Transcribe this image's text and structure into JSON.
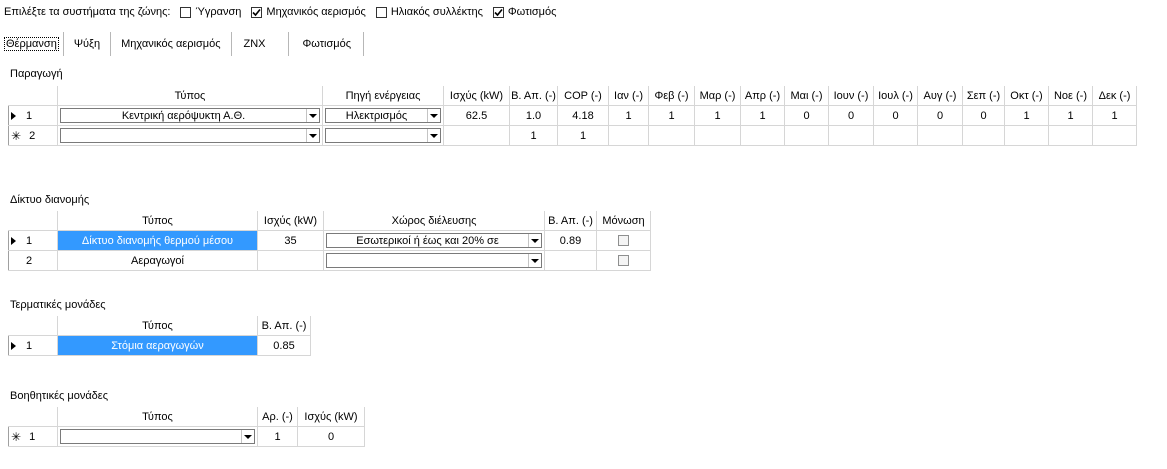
{
  "zone_systems": {
    "label": "Επιλέξτε τα συστήματα της ζώνης:",
    "options": [
      {
        "label": "Ύγρανση",
        "checked": false
      },
      {
        "label": "Μηχανικός αερισμός",
        "checked": true
      },
      {
        "label": "Ηλιακός συλλέκτης",
        "checked": false
      },
      {
        "label": "Φωτισμός",
        "checked": true
      }
    ]
  },
  "tabs": [
    {
      "label": "Θέρμανση",
      "active": true
    },
    {
      "label": "Ψύξη",
      "active": false
    },
    {
      "label": "Μηχανικός αερισμός",
      "active": false
    },
    {
      "label": "ZNX",
      "active": false
    },
    {
      "label": "Φωτισμός",
      "active": false
    }
  ],
  "production": {
    "title": "Παραγωγή",
    "headers": [
      "Τύπος",
      "Πηγή ενέργειας",
      "Ισχύς (kW)",
      "Β. Απ. (-)",
      "COP (-)",
      "Ιαν (-)",
      "Φεβ (-)",
      "Μαρ (-)",
      "Απρ (-)",
      "Μαι (-)",
      "Ιουν (-)",
      "Ιουλ (-)",
      "Αυγ (-)",
      "Σεπ (-)",
      "Οκτ (-)",
      "Νοε (-)",
      "Δεκ (-)"
    ],
    "rows": [
      {
        "num": "1",
        "marker": "current",
        "type": "Κεντρική αερόψυκτη Α.Θ.",
        "source": "Ηλεκτρισμός",
        "power": "62.5",
        "eff": "1.0",
        "cop": "4.18",
        "months": [
          "1",
          "1",
          "1",
          "1",
          "0",
          "0",
          "0",
          "0",
          "0",
          "1",
          "1",
          "1"
        ]
      },
      {
        "num": "2",
        "marker": "new",
        "type": "",
        "source": "",
        "power": "",
        "eff": "1",
        "cop": "1",
        "months": [
          "",
          "",
          "",
          "",
          "",
          "",
          "",
          "",
          "",
          "",
          "",
          ""
        ]
      }
    ]
  },
  "distribution": {
    "title": "Δίκτυο διανομής",
    "headers": [
      "Τύπος",
      "Ισχύς (kW)",
      "Χώρος διέλευσης",
      "Β. Απ. (-)",
      "Μόνωση"
    ],
    "rows": [
      {
        "num": "1",
        "marker": "current",
        "type": "Δίκτυο διανομής θερμού μέσου",
        "power": "35",
        "space": "Εσωτερικοί  ή έως και 20% σε",
        "eff": "0.89",
        "insulation": false
      },
      {
        "num": "2",
        "marker": "none",
        "type": "Αεραγωγοί",
        "power": "",
        "space": "",
        "eff": "",
        "insulation": false
      }
    ]
  },
  "terminal": {
    "title": "Τερματικές μονάδες",
    "headers": [
      "Τύπος",
      "Β. Απ. (-)"
    ],
    "rows": [
      {
        "num": "1",
        "marker": "current",
        "type": "Στόμια αεραγωγών",
        "eff": "0.85"
      }
    ]
  },
  "auxiliary": {
    "title": "Βοηθητικές μονάδες",
    "headers": [
      "Τύπος",
      "Αρ. (-)",
      "Ισχύς (kW)"
    ],
    "rows": [
      {
        "num": "1",
        "marker": "new",
        "type": "",
        "count": "1",
        "power": "0"
      }
    ]
  }
}
